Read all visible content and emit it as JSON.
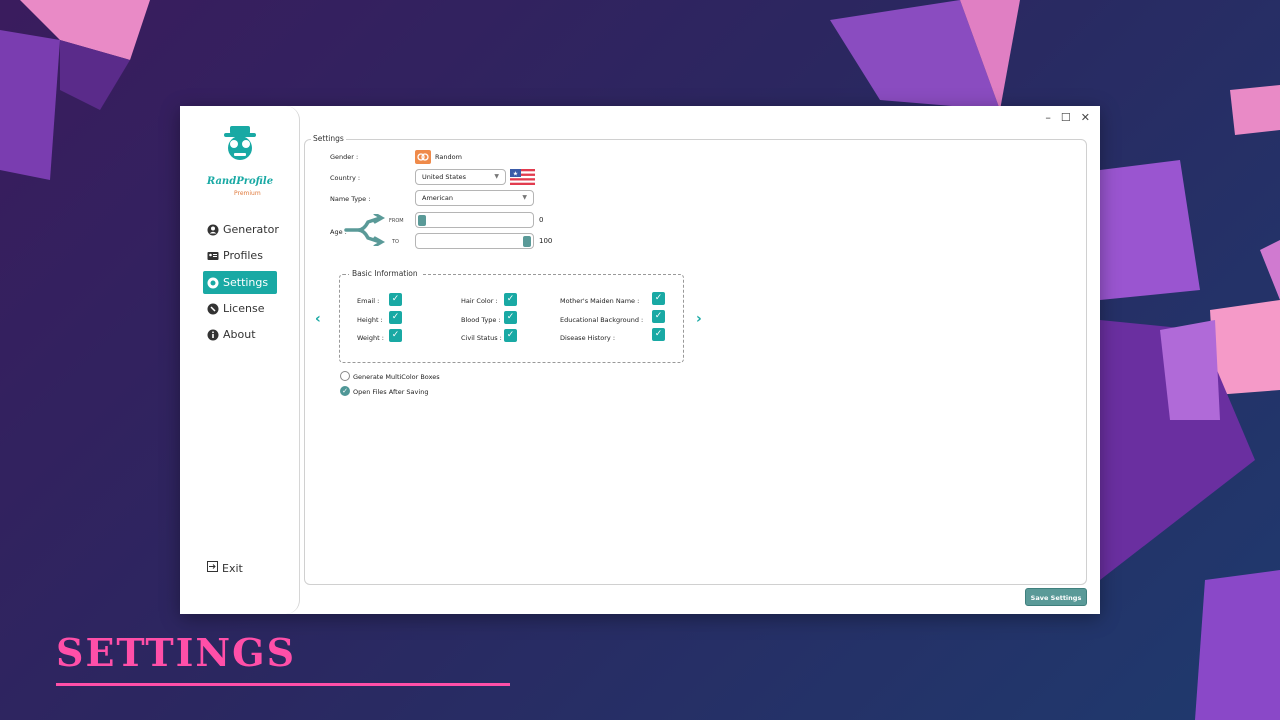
{
  "app": {
    "logo_text": "RandProfile",
    "logo_sub": "Premium"
  },
  "window_controls": {
    "minimize": "–",
    "maximize": "☐",
    "close": "✕"
  },
  "sidebar": {
    "items": [
      {
        "label": "Generator",
        "icon": "user-icon"
      },
      {
        "label": "Profiles",
        "icon": "id-card-icon"
      },
      {
        "label": "Settings",
        "icon": "gear-icon",
        "active": true
      },
      {
        "label": "License",
        "icon": "license-icon"
      },
      {
        "label": "About",
        "icon": "info-icon"
      }
    ],
    "exit_label": "Exit"
  },
  "settings": {
    "title": "Settings",
    "gender_label": "Gender :",
    "gender_value": "Random",
    "country_label": "Country :",
    "country_value": "United States",
    "name_type_label": "Name Type :",
    "name_type_value": "American",
    "age_label": "Age :",
    "from_label": "FROM",
    "to_label": "TO",
    "age_from": "0",
    "age_to": "100"
  },
  "basic_info": {
    "title": "Basic Information",
    "fields": [
      [
        "Email :",
        "Hair Color :",
        "Mother's Maiden Name :"
      ],
      [
        "Height :",
        "Blood Type :",
        "Educational Background :"
      ],
      [
        "Weight :",
        "Civil Status :",
        "Disease History :"
      ]
    ]
  },
  "options": {
    "multicolor": "Generate MultiColor Boxes",
    "open_files": "Open Files After Saving"
  },
  "save_button": "Save Settings",
  "caption": "SETTINGS",
  "colors": {
    "accent": "#19a9a4",
    "caption": "#ff4fa8",
    "button": "#5a9a98"
  }
}
